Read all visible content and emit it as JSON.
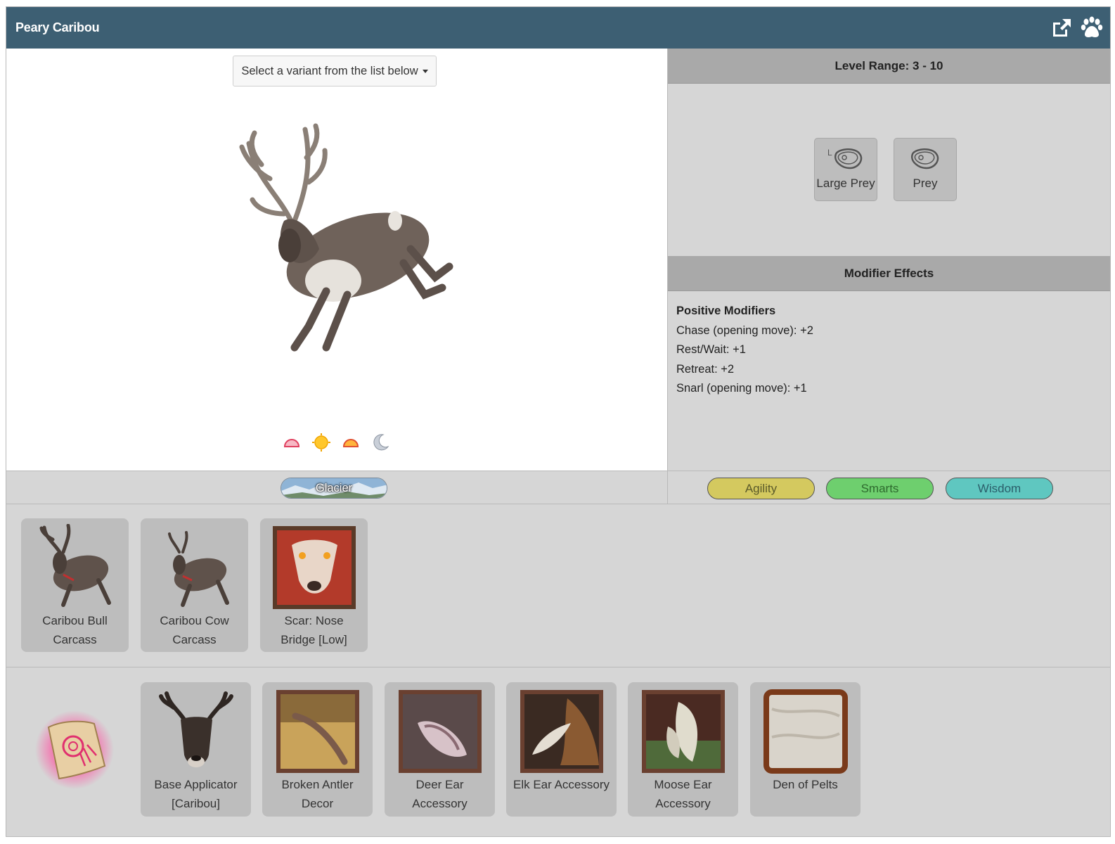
{
  "header": {
    "title": "Peary Caribou",
    "popout_icon": "external-link-icon",
    "paw_icon": "paw-icon"
  },
  "variant_select": {
    "label": "Select a variant from the list below"
  },
  "time_of_day_icons": [
    "dawn-icon",
    "day-sun-icon",
    "dusk-icon",
    "night-moon-icon"
  ],
  "level": {
    "heading": "Level Range: 3 - 10"
  },
  "prey_types": [
    {
      "label": "Large Prey",
      "icon": "large-prey-meat-icon"
    },
    {
      "label": "Prey",
      "icon": "prey-meat-icon"
    }
  ],
  "modifiers": {
    "heading": "Modifier Effects",
    "positive_heading": "Positive Modifiers",
    "items": [
      "Chase (opening move): +2",
      "Rest/Wait: +1",
      "Retreat: +2",
      "Snarl (opening move): +1"
    ]
  },
  "biome": {
    "label": "Glacier"
  },
  "stats": [
    {
      "label": "Agility",
      "color": "#d4c95f"
    },
    {
      "label": "Smarts",
      "color": "#6ecf6e"
    },
    {
      "label": "Wisdom",
      "color": "#5fc7c0"
    }
  ],
  "drops": [
    {
      "line1": "Caribou Bull",
      "line2": "Carcass"
    },
    {
      "line1": "Caribou Cow",
      "line2": "Carcass"
    },
    {
      "line1": "Scar: Nose",
      "line2": "Bridge [Low]"
    }
  ],
  "unlocks": [
    {
      "line1": "Base Applicator",
      "line2": "[Caribou]"
    },
    {
      "line1": "Broken Antler",
      "line2": "Decor"
    },
    {
      "line1": "Deer Ear",
      "line2": "Accessory"
    },
    {
      "line1": "Elk Ear Accessory",
      "line2": ""
    },
    {
      "line1": "Moose Ear",
      "line2": "Accessory"
    },
    {
      "line1": "Den of Pelts",
      "line2": ""
    }
  ],
  "colors": {
    "header_bg": "#3d5f73",
    "panel_bg": "#d6d6d6",
    "section_head_bg": "#a9a9a9",
    "card_bg": "#bdbdbd"
  }
}
